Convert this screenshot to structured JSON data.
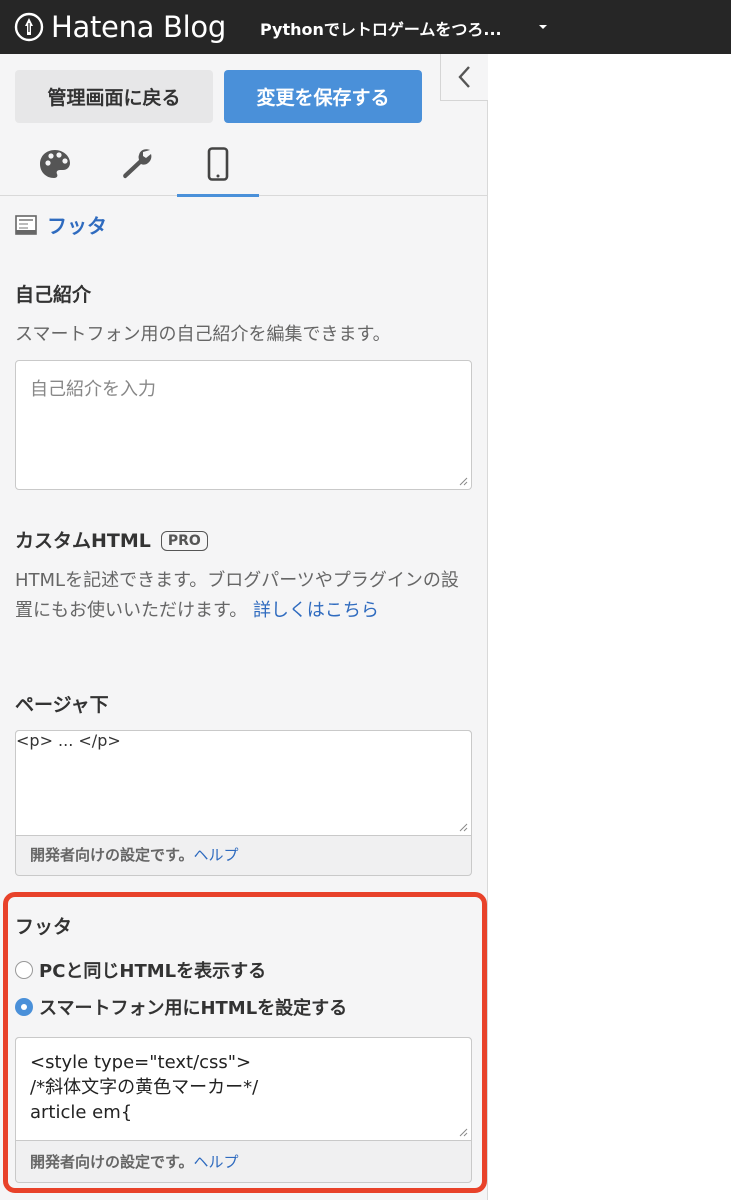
{
  "header": {
    "logo_text": "Hatena Blog",
    "blog_title": "Pythonでレトロゲームをつろ..."
  },
  "toolbar": {
    "back_label": "管理画面に戻る",
    "save_label": "変更を保存する"
  },
  "tabs": [
    {
      "icon": "palette-icon",
      "active": false
    },
    {
      "icon": "wrench-icon",
      "active": false
    },
    {
      "icon": "smartphone-icon",
      "active": true
    }
  ],
  "section": {
    "title": "フッタ"
  },
  "profile": {
    "heading": "自己紹介",
    "description": "スマートフォン用の自己紹介を編集できます。",
    "placeholder": "自己紹介を入力"
  },
  "custom_html": {
    "heading": "カスタムHTML",
    "badge": "PRO",
    "description": "HTMLを記述できます。ブログパーツやプラグインの設置にもお使いいただけます。",
    "link": "詳しくはこちら"
  },
  "page_bottom": {
    "heading": "ページャ下",
    "placeholder": "<p> ... </p>",
    "note": "開発者向けの設定です。",
    "help": "ヘルプ"
  },
  "footer": {
    "heading": "フッタ",
    "options": [
      {
        "label": "PCと同じHTMLを表示する",
        "checked": false
      },
      {
        "label": "スマートフォン用にHTMLを設定する",
        "checked": true
      }
    ],
    "code": "<style type=\"text/css\">\n/*斜体文字の黄色マーカー*/\narticle em{",
    "note": "開発者向けの設定です。",
    "help": "ヘルプ"
  },
  "colors": {
    "accent": "#4a90d9",
    "link": "#2f6bbf",
    "highlight": "#e8422a",
    "topbar": "#262626"
  }
}
